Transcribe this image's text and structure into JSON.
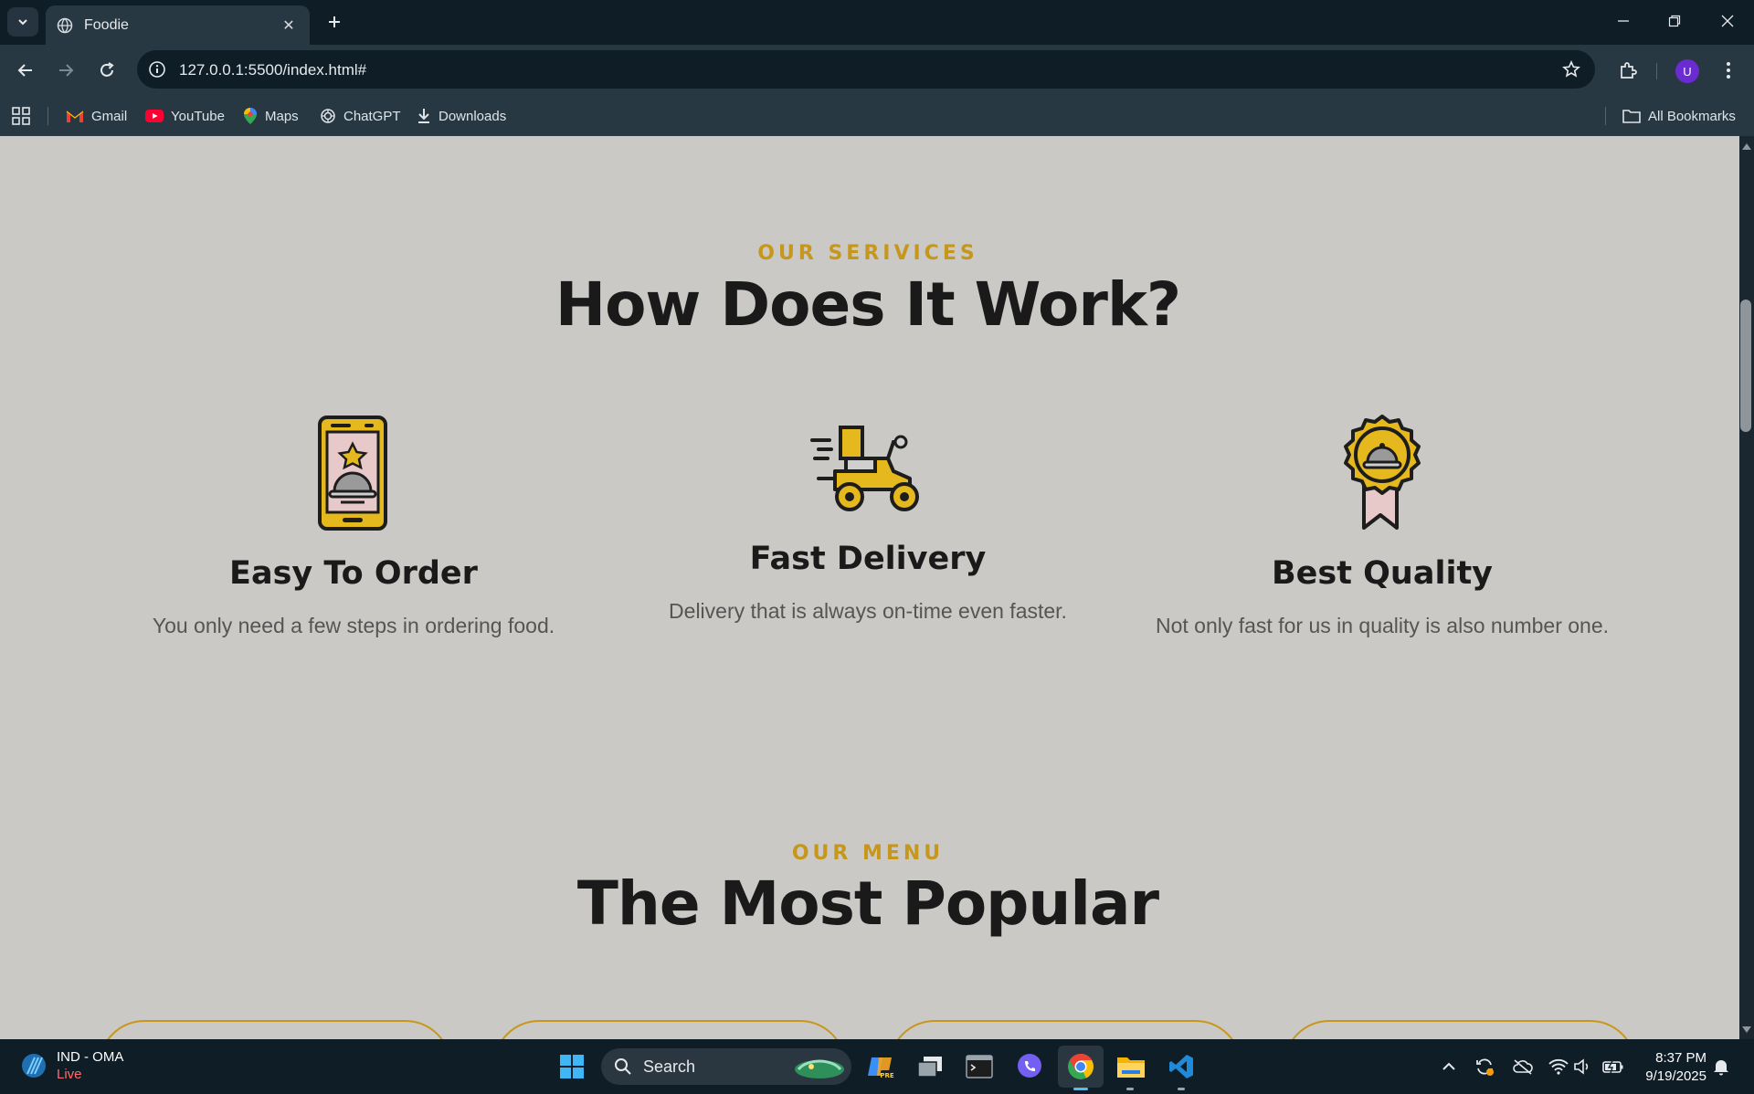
{
  "browser": {
    "tab_title": "Foodie",
    "url": "127.0.0.1:5500/index.html#",
    "avatar_letter": "U",
    "bookmarks": [
      "Gmail",
      "YouTube",
      "Maps",
      "ChatGPT",
      "Downloads"
    ],
    "all_bookmarks": "All Bookmarks"
  },
  "services": {
    "kicker": "OUR SERIVICES",
    "title": "How Does It Work?",
    "items": [
      {
        "icon": "phone-order-icon",
        "title": "Easy To Order",
        "desc": "You only need a few steps in ordering food."
      },
      {
        "icon": "scooter-delivery-icon",
        "title": "Fast Delivery",
        "desc": "Delivery that is always on-time even faster."
      },
      {
        "icon": "quality-badge-icon",
        "title": "Best Quality",
        "desc": "Not only fast for us in quality is also number one."
      }
    ]
  },
  "menu": {
    "kicker": "OUR MENU",
    "title": "The Most Popular"
  },
  "taskbar": {
    "weather_title": "IND - OMA",
    "weather_status": "Live",
    "search_label": "Search",
    "time": "8:37 PM",
    "date": "9/19/2025"
  },
  "colors": {
    "accent": "#c7971c",
    "page_bg": "#cbc9c5",
    "chrome_dark": "#0f1d27",
    "chrome": "#273843"
  }
}
